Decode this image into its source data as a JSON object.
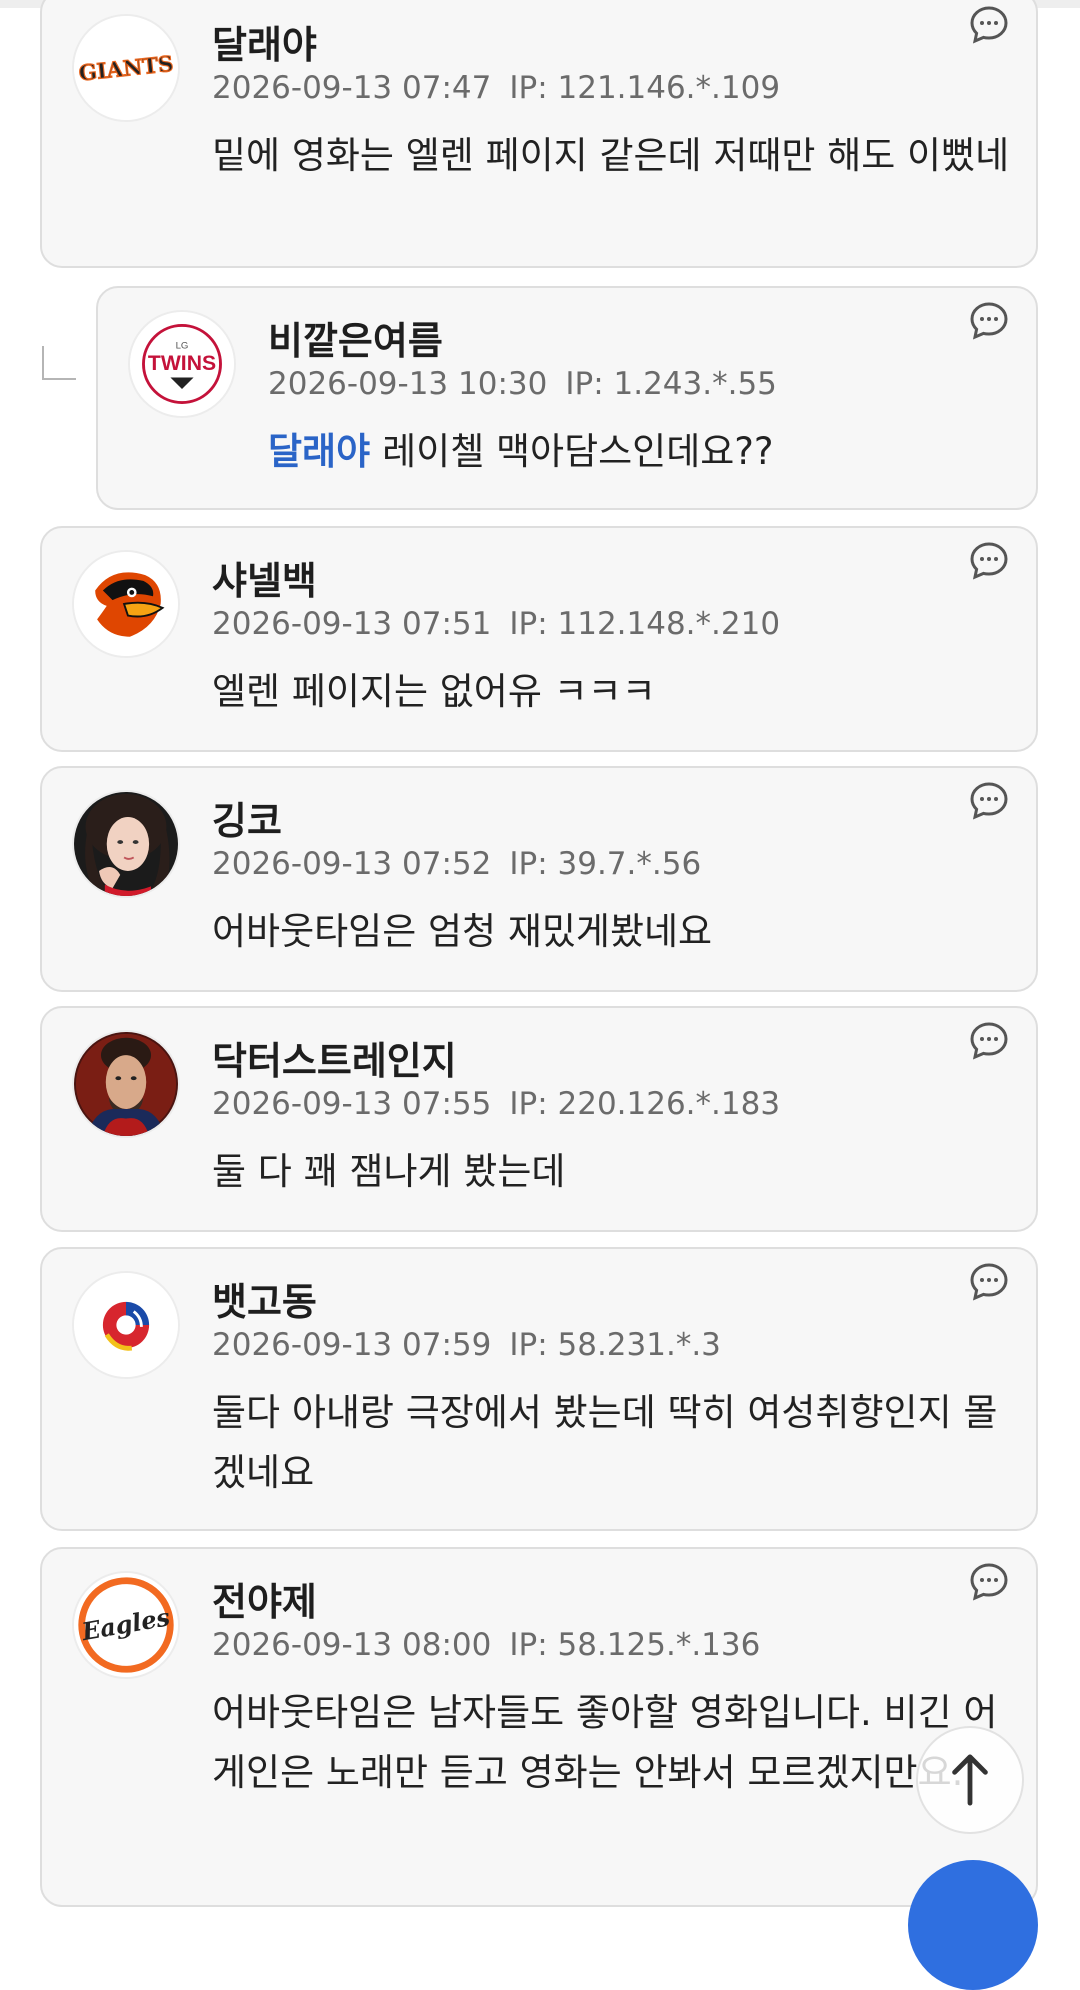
{
  "comments": [
    {
      "nickname": "달래야",
      "datetime": "2026-09-13 07:47",
      "ip": "IP: 121.146.*.109",
      "text": "밑에 영화는 엘렌 페이지 같은데 저때만 해도 이뻤네",
      "avatar": "giants-logo-icon",
      "avatar_text": "GIANTS"
    },
    {
      "nickname": "비깥은여름",
      "datetime": "2026-09-13 10:30",
      "ip": "IP: 1.243.*.55",
      "mention": "달래야",
      "text": "레이첼 맥아담스인데요??",
      "avatar": "lg-twins-logo-icon",
      "avatar_text": "TWINS",
      "avatar_subtext": "LG"
    },
    {
      "nickname": "샤넬백",
      "datetime": "2026-09-13 07:51",
      "ip": "IP: 112.148.*.210",
      "text": "엘렌 페이지는 없어유 ㅋㅋㅋ",
      "avatar": "orioles-bird-logo-icon"
    },
    {
      "nickname": "깅코",
      "datetime": "2026-09-13 07:52",
      "ip": "IP: 39.7.*.56",
      "text": "어바웃타임은 엄청 재밌게봤네요",
      "avatar": "woman-portrait-avatar"
    },
    {
      "nickname": "닥터스트레인지",
      "datetime": "2026-09-13 07:55",
      "ip": "IP: 220.126.*.183",
      "text": "둘 다 꽤 잼나게 봤는데",
      "avatar": "doctor-strange-portrait-avatar"
    },
    {
      "nickname": "뱃고동",
      "datetime": "2026-09-13 07:59",
      "ip": "IP: 58.231.*.3",
      "text": "둘다 아내랑 극장에서 봤는데 딱히 여성취향인지 몰겠네요",
      "avatar": "korea-baseball-logo-icon"
    },
    {
      "nickname": "전야제",
      "datetime": "2026-09-13 08:00",
      "ip": "IP: 58.125.*.136",
      "text": "어바웃타임은 남자들도 좋아할 영화입니다. 비긴 어게인은 노래만 듣고 영화는 안봐서 모르겠지만요.",
      "avatar": "eagles-logo-icon",
      "avatar_text": "Eagles"
    }
  ],
  "icons": {
    "reply": "comment-bubble-icon",
    "scroll_top": "arrow-up-icon"
  },
  "colors": {
    "mention": "#2a64c7",
    "card_bg": "#f7f7f7",
    "card_border": "#dedede",
    "fab": "#2f6fe0"
  }
}
